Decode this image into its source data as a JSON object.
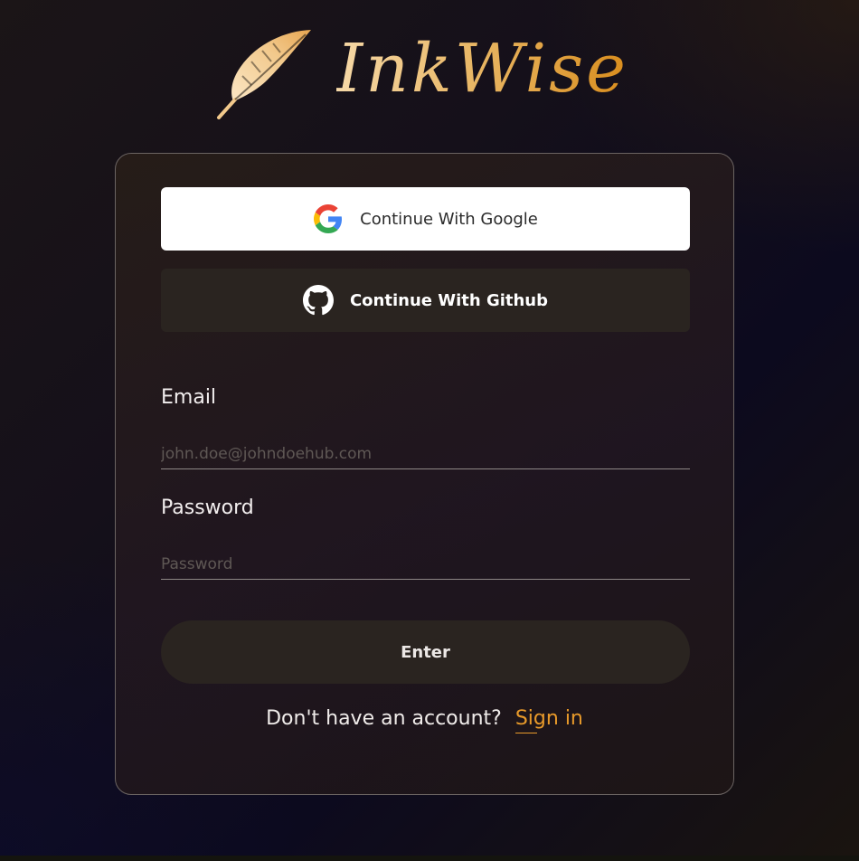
{
  "brand": {
    "name": "InkWise",
    "logo_icon": "feather-icon",
    "gradient_colors": [
      "#f6d9a8",
      "#e9b868",
      "#d98d1d"
    ]
  },
  "oauth": {
    "google": {
      "label": "Continue With Google",
      "icon": "google-icon"
    },
    "github": {
      "label": "Continue With Github",
      "icon": "github-icon"
    }
  },
  "form": {
    "email": {
      "label": "Email",
      "placeholder": "john.doe@johndoehub.com",
      "value": ""
    },
    "password": {
      "label": "Password",
      "placeholder": "Password",
      "value": ""
    },
    "submit_label": "Enter"
  },
  "footer": {
    "prompt": "Don't have an account?",
    "link_label": "Sign in"
  },
  "colors": {
    "accent": "#e89a2a",
    "card_border": "#6b6462",
    "button_dark": "#2a2420"
  }
}
